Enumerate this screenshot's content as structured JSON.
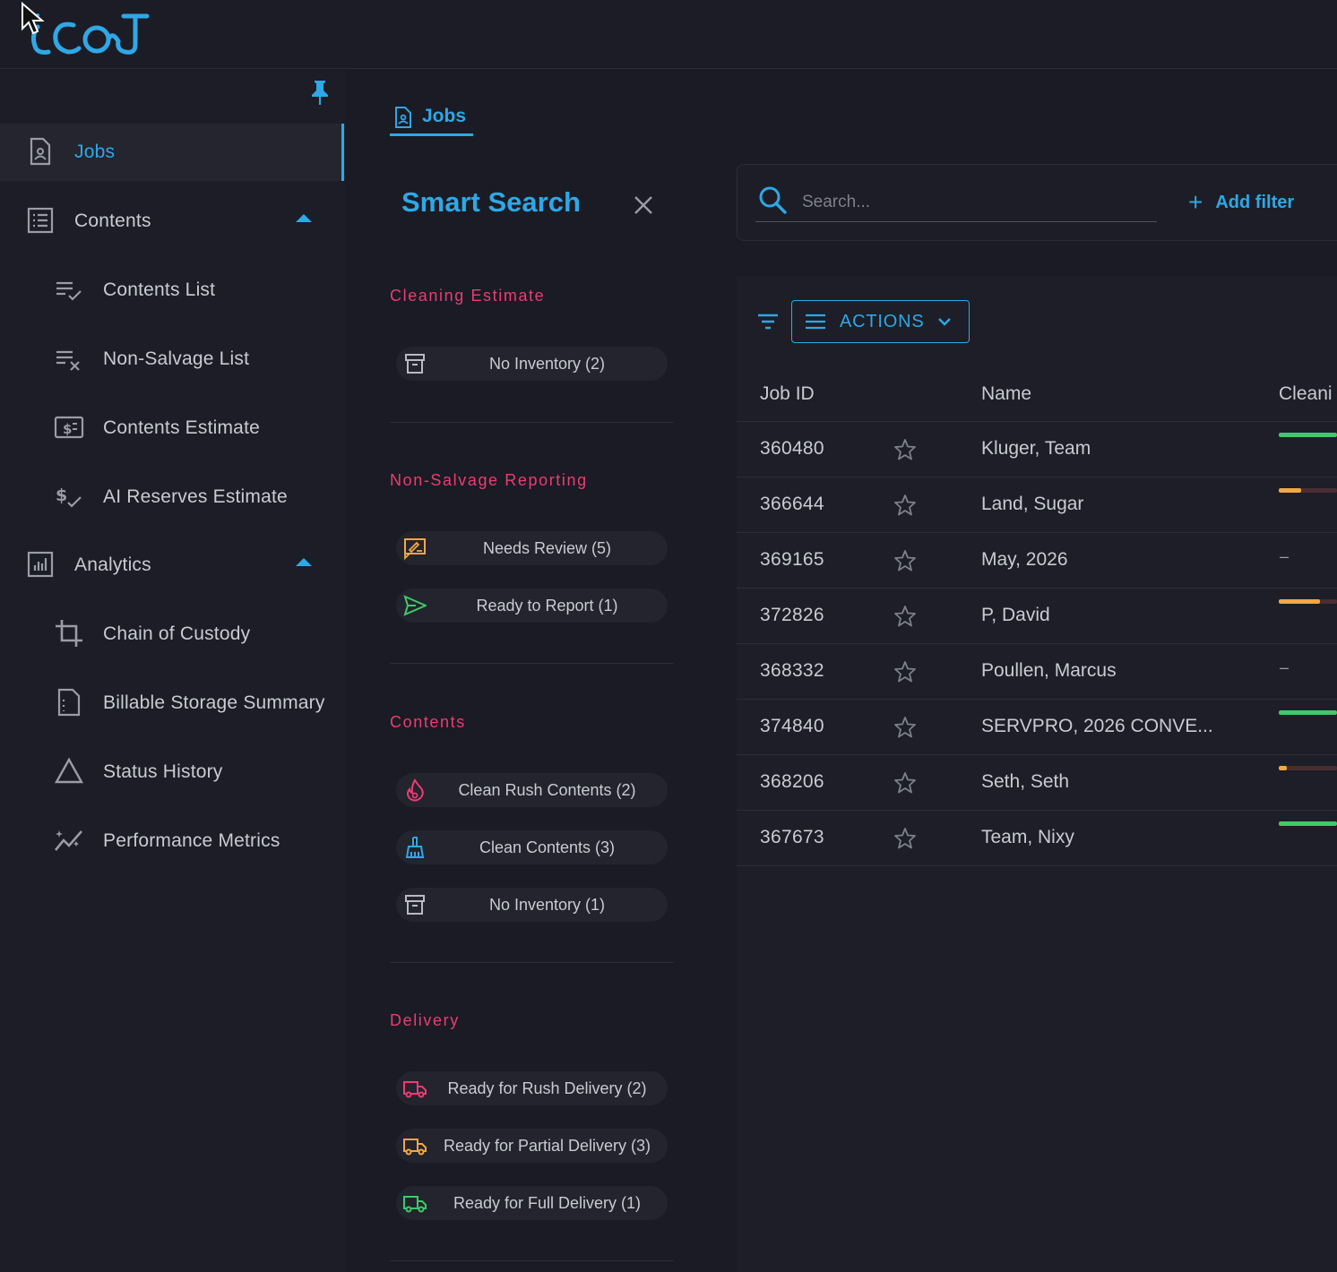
{
  "app": {
    "logo_text": "iCad",
    "brand_color": "#2ea8e6",
    "accent_pink": "#ec3c73"
  },
  "sidebar": {
    "items": [
      {
        "label": "Jobs",
        "icon": "document-person-icon",
        "active": true
      },
      {
        "label": "Contents",
        "icon": "list-box-icon",
        "expanded": true
      },
      {
        "label": "Contents List",
        "icon": "list-check-icon"
      },
      {
        "label": "Non-Salvage List",
        "icon": "list-x-icon"
      },
      {
        "label": "Contents Estimate",
        "icon": "dollar-box-icon"
      },
      {
        "label": "AI Reserves Estimate",
        "icon": "dollar-check-icon"
      },
      {
        "label": "Analytics",
        "icon": "chart-box-icon",
        "expanded": true
      },
      {
        "label": "Chain of Custody",
        "icon": "crop-icon"
      },
      {
        "label": "Billable Storage Summary",
        "icon": "document-dashed-icon"
      },
      {
        "label": "Status History",
        "icon": "triangle-icon"
      },
      {
        "label": "Performance Metrics",
        "icon": "sparkle-chart-icon"
      }
    ]
  },
  "tab": {
    "label": "Jobs"
  },
  "smart_search": {
    "title": "Smart Search",
    "sections": [
      {
        "title": "Cleaning Estimate",
        "pills": [
          {
            "label": "No Inventory (2)",
            "icon": "archive-icon"
          }
        ]
      },
      {
        "title": "Non-Salvage Reporting",
        "pills": [
          {
            "label": "Needs Review (5)",
            "icon": "review-icon",
            "color": "#f5a742"
          },
          {
            "label": "Ready to Report (1)",
            "icon": "send-icon",
            "color": "#3fc96a"
          }
        ]
      },
      {
        "title": "Contents",
        "pills": [
          {
            "label": "Clean Rush Contents (2)",
            "icon": "fire-icon",
            "color": "#ec3c73"
          },
          {
            "label": "Clean Contents (3)",
            "icon": "broom-icon",
            "color": "#2ea8e6"
          },
          {
            "label": "No Inventory (1)",
            "icon": "archive-icon"
          }
        ]
      },
      {
        "title": "Delivery",
        "pills": [
          {
            "label": "Ready for Rush Delivery (2)",
            "icon": "truck-icon",
            "color": "#ec3c73"
          },
          {
            "label": "Ready for Partial Delivery (3)",
            "icon": "truck-icon",
            "color": "#f5a742"
          },
          {
            "label": "Ready for Full Delivery (1)",
            "icon": "truck-icon",
            "color": "#3fc96a"
          }
        ]
      }
    ]
  },
  "search": {
    "placeholder": "Search...",
    "add_filter_label": "Add filter"
  },
  "toolbar": {
    "actions_label": "ACTIONS"
  },
  "table": {
    "headers": {
      "job_id": "Job ID",
      "name": "Name",
      "cleaning": "Cleani"
    },
    "rows": [
      {
        "id": "360480",
        "name": "Kluger, Team",
        "progress": 1.0,
        "progress_color": "#3fc96a"
      },
      {
        "id": "366644",
        "name": "Land, Sugar",
        "progress": 0.38,
        "progress_color": "#f5a742"
      },
      {
        "id": "369165",
        "name": "May, 2026",
        "progress": null,
        "dash": "–"
      },
      {
        "id": "372826",
        "name": "P, David",
        "progress": 0.7,
        "progress_color": "#f5a742"
      },
      {
        "id": "368332",
        "name": "Poullen, Marcus",
        "progress": null,
        "dash": "–"
      },
      {
        "id": "374840",
        "name": "SERVPRO, 2026 CONVE...",
        "progress": 1.0,
        "progress_color": "#3fc96a"
      },
      {
        "id": "368206",
        "name": "Seth, Seth",
        "progress": 0.14,
        "progress_color": "#f5a742"
      },
      {
        "id": "367673",
        "name": "Team, Nixy",
        "progress": 1.0,
        "progress_color": "#3fc96a"
      }
    ]
  }
}
